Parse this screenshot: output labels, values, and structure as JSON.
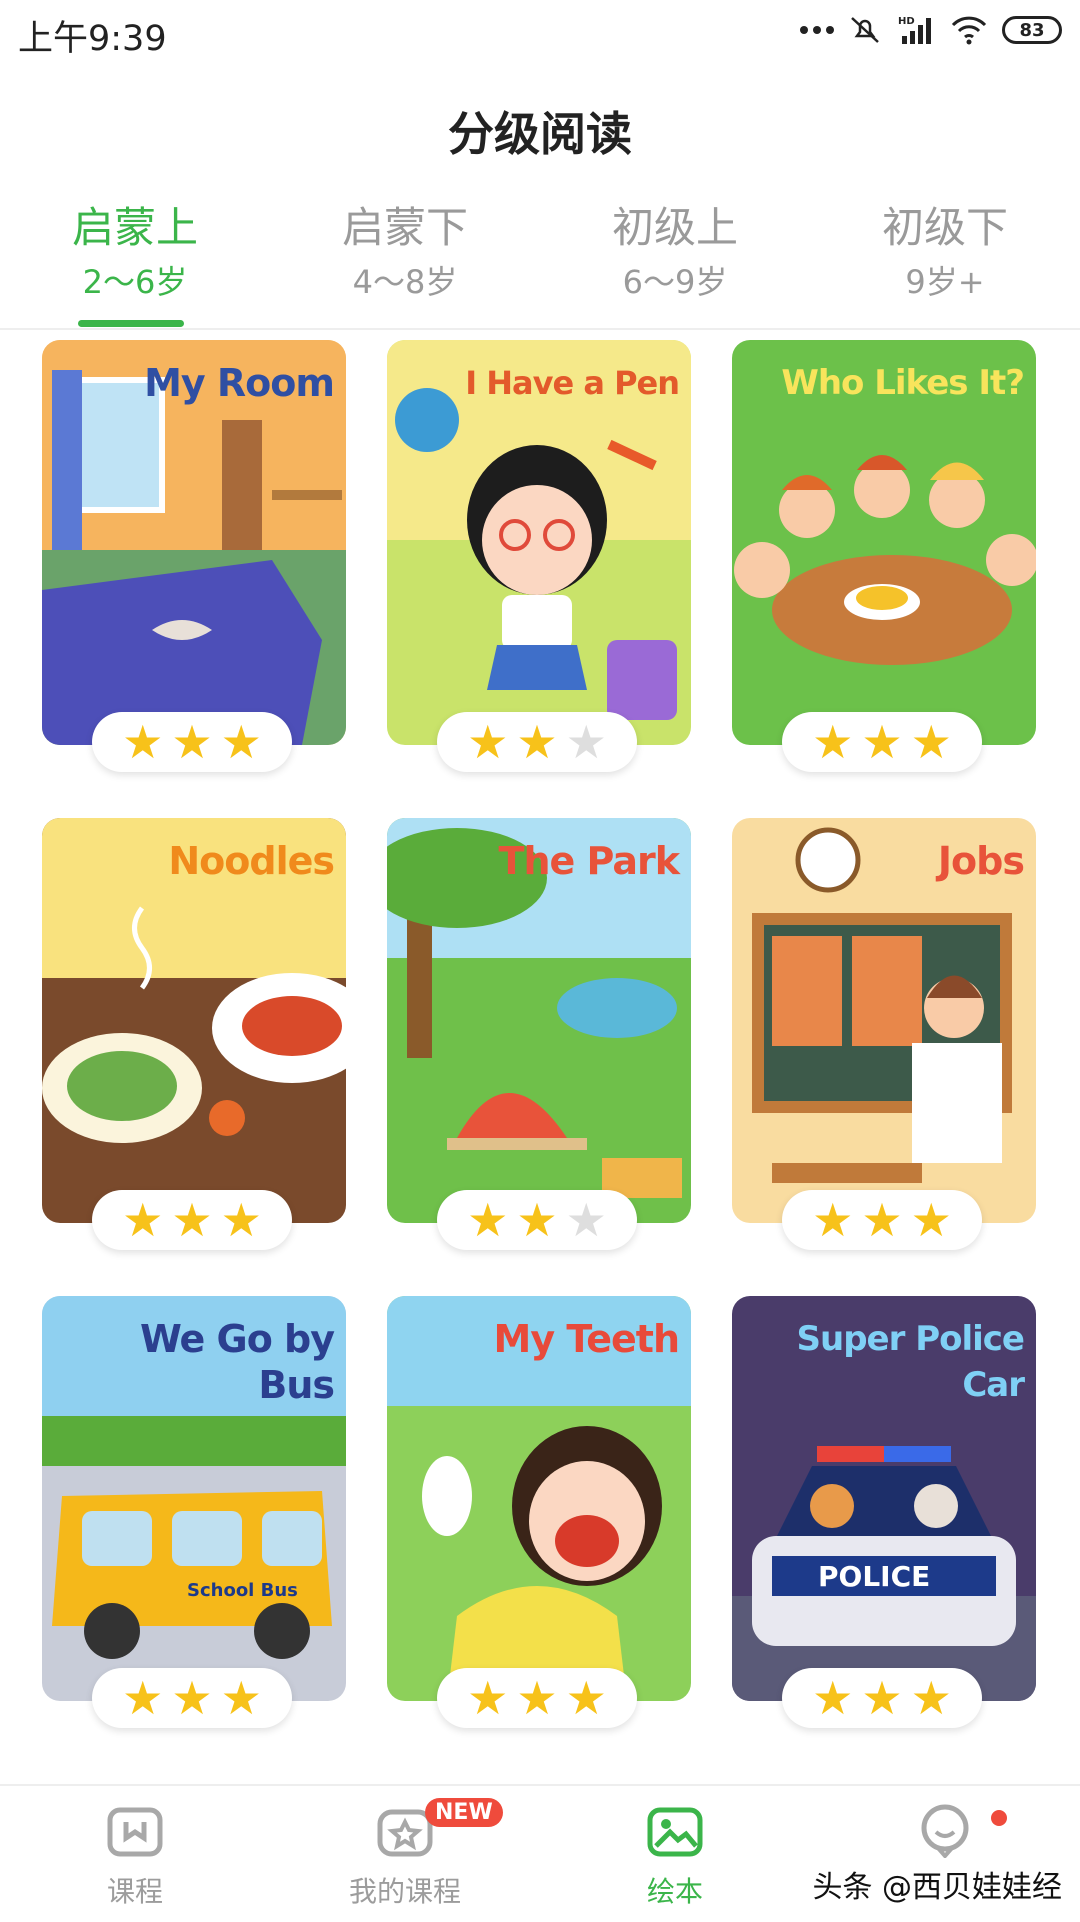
{
  "status_bar": {
    "time": "上午9:39",
    "battery": "83",
    "network": "HD"
  },
  "page_title": "分级阅读",
  "tabs": [
    {
      "name": "启蒙上",
      "age": "2～6岁",
      "active": true
    },
    {
      "name": "启蒙下",
      "age": "4～8岁",
      "active": false
    },
    {
      "name": "初级上",
      "age": "6～9岁",
      "active": false
    },
    {
      "name": "初级下",
      "age": "9岁+",
      "active": false
    }
  ],
  "books": [
    {
      "title": "My Room",
      "stars": 3,
      "title_color": "#2f4fa3"
    },
    {
      "title": "I Have a Pen",
      "stars": 2,
      "title_color": "#e35a2b"
    },
    {
      "title": "Who Likes It?",
      "stars": 3,
      "title_color": "#f8e45c"
    },
    {
      "title": "Noodles",
      "stars": 3,
      "title_color": "#f08a1c"
    },
    {
      "title": "The Park",
      "stars": 2,
      "title_color": "#e8533a"
    },
    {
      "title": "Jobs",
      "stars": 3,
      "title_color": "#e8533a"
    },
    {
      "title": "We Go by Bus",
      "stars": 3,
      "title_color": "#2b3f8f"
    },
    {
      "title": "My Teeth",
      "stars": 3,
      "title_color": "#e84a3a"
    },
    {
      "title": "Super Police Car",
      "stars": 3,
      "title_color": "#7fd0f5"
    }
  ],
  "bottom_nav": [
    {
      "label": "课程",
      "icon": "course-icon",
      "active": false
    },
    {
      "label": "我的课程",
      "icon": "my-course-icon",
      "active": false,
      "badge": "NEW"
    },
    {
      "label": "绘本",
      "icon": "picture-book-icon",
      "active": true
    },
    {
      "label": "",
      "icon": "profile-icon",
      "active": false,
      "dot": true
    }
  ],
  "watermark": "头条 @西贝娃娃经",
  "colors": {
    "accent": "#3bb54a",
    "star_on": "#f7c21a",
    "star_off": "#dedede",
    "badge": "#ef4b3c"
  }
}
